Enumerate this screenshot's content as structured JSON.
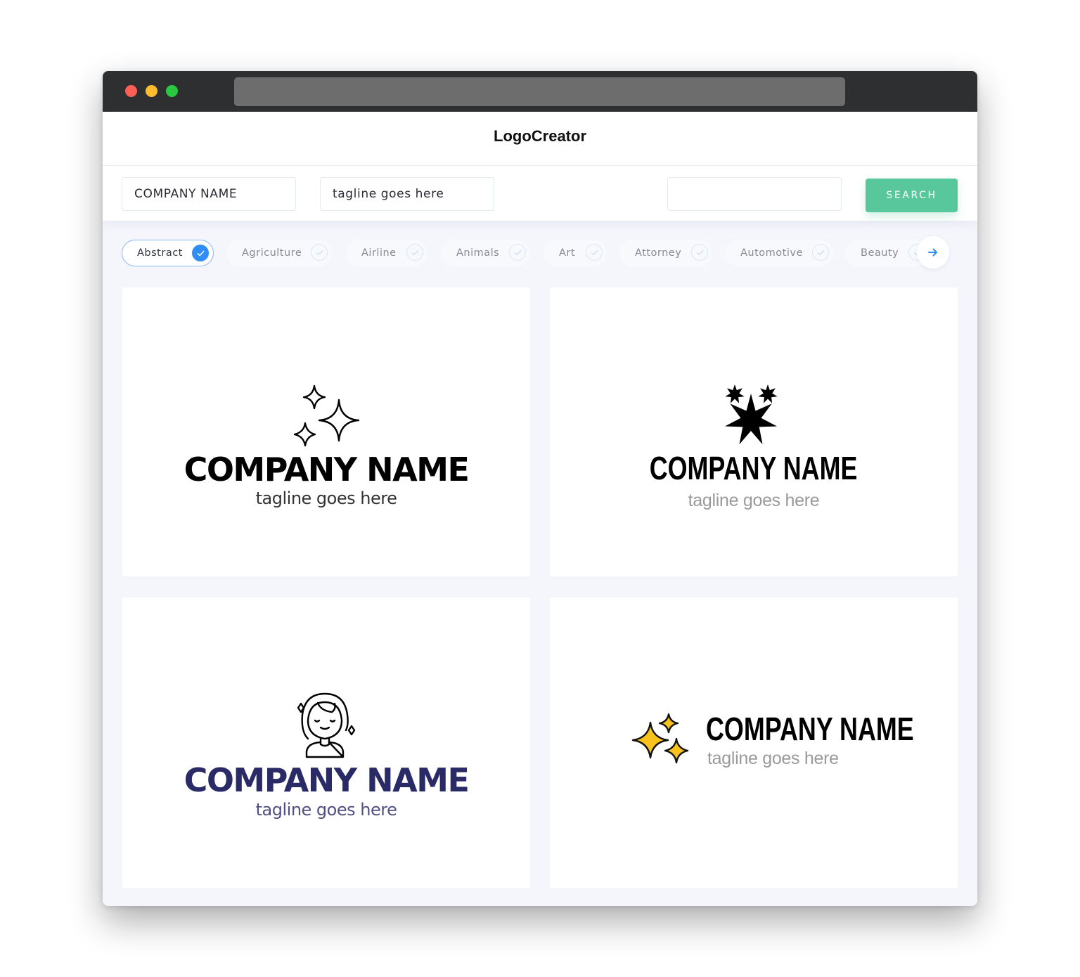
{
  "window": {
    "traffic_lights": [
      "close",
      "minimize",
      "maximize"
    ],
    "colors": {
      "close": "#fd5f57",
      "minimize": "#febc2e",
      "maximize": "#29c840"
    }
  },
  "header": {
    "brand": "LogoCreator"
  },
  "search": {
    "company_value": "COMPANY NAME",
    "tagline_value": "tagline goes here",
    "keyword_value": "",
    "button_label": "SEARCH",
    "button_color": "#58c89c"
  },
  "categories": {
    "items": [
      {
        "label": "Abstract",
        "selected": true
      },
      {
        "label": "Agriculture",
        "selected": false
      },
      {
        "label": "Airline",
        "selected": false
      },
      {
        "label": "Animals",
        "selected": false
      },
      {
        "label": "Art",
        "selected": false
      },
      {
        "label": "Attorney",
        "selected": false
      },
      {
        "label": "Automotive",
        "selected": false
      },
      {
        "label": "Beauty",
        "selected": false
      }
    ],
    "next_icon": "arrow-right-icon",
    "accent_color": "#2f8df5"
  },
  "logos": [
    {
      "icon": "sparkles-outline-icon",
      "name": "COMPANY NAME",
      "tagline": "tagline goes here",
      "name_color": "#000000",
      "tagline_color": "#333333"
    },
    {
      "icon": "three-stars-filled-icon",
      "name": "COMPANY NAME",
      "tagline": "tagline goes here",
      "name_color": "#000000",
      "tagline_color": "#9a9a9a"
    },
    {
      "icon": "woman-face-sparkles-icon",
      "name": "COMPANY NAME",
      "tagline": "tagline goes here",
      "name_color": "#2a2a66",
      "tagline_color": "#4f4f86"
    },
    {
      "icon": "sparkles-yellow-icon",
      "name": "COMPANY NAME",
      "tagline": "tagline goes here",
      "name_color": "#000000",
      "tagline_color": "#9a9a9a"
    }
  ]
}
